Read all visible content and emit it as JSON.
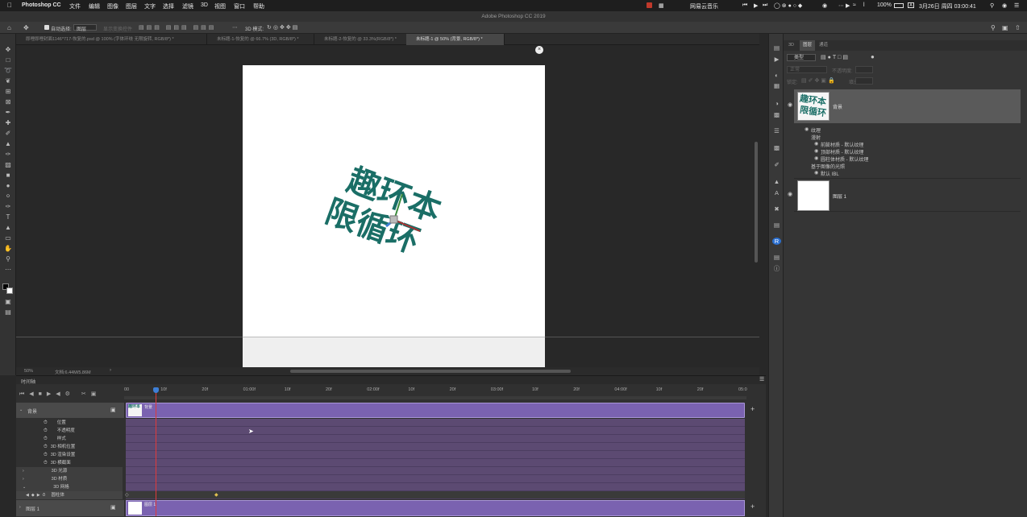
{
  "menubar": {
    "apple": "",
    "app_name": "Photoshop CC",
    "items": [
      "文件",
      "编辑",
      "图像",
      "图层",
      "文字",
      "选择",
      "滤镜",
      "3D",
      "视图",
      "窗口",
      "帮助"
    ],
    "netease": "网易云音乐",
    "battery": "100%",
    "datetime": "3月26日 周四 03:00:41"
  },
  "window_title": "Adobe Photoshop CC 2019",
  "options": {
    "auto_select": "自动选择:",
    "auto_select_target": "图层",
    "show_transform": "显示变换控件",
    "mode_3d": "3D 模式:"
  },
  "tabs": [
    "即哩即哩封面1146*717-恢复的.psd @ 100% (字体环绕 无限旋转, RGB/8*) *",
    "未标题-1-恢复的 @ 66.7% (3D, RGB/8*) *",
    "未标题-2-恢复的 @ 33.3%(RGB/8*) *",
    "未标题-1 @ 50% (背景, RGB/8*) *"
  ],
  "canvas_text": {
    "top_row": "趣环本",
    "bottom_row": "限循环"
  },
  "status": {
    "zoom": "50%",
    "doc": "文档:6.44M/5.86M"
  },
  "panel_tabs": [
    "3D",
    "图层",
    "通道"
  ],
  "layers_panel": {
    "filter_label": "类型",
    "blend_mode": "正常",
    "opacity_label": "不透明度:",
    "lock_label": "锁定:",
    "fill_label": "填充:",
    "layers": [
      {
        "name": "背景",
        "selected": true,
        "children": [
          {
            "name": "纹理",
            "indent": 0
          },
          {
            "name": "漫射",
            "indent": 1
          },
          {
            "name": "前膨材质 - 默认纹理",
            "indent": 2
          },
          {
            "name": "顶部材质 - 默认纹理",
            "indent": 2
          },
          {
            "name": "圆柱体材质 - 默认纹理",
            "indent": 2
          },
          {
            "name": "基于图像的光照",
            "indent": 1
          },
          {
            "name": "默认 IBL",
            "indent": 2
          }
        ]
      },
      {
        "name": "图层 1",
        "selected": false
      }
    ]
  },
  "timeline": {
    "panel_title": "时间轴",
    "ruler_labels": [
      "00",
      "10f",
      "20f",
      "01:00f",
      "10f",
      "20f",
      "02:00f",
      "10f",
      "20f",
      "03:00f",
      "10f",
      "20f",
      "04:00f",
      "10f",
      "20f",
      "05:0"
    ],
    "track1_name": "背景",
    "track1_clip": "背景",
    "properties": [
      "位置",
      "不透明度",
      "样式",
      "3D 相机位置",
      "3D 渲染设置",
      "3D 横截面"
    ],
    "groups": [
      "3D 光源",
      "3D 材质",
      "3D 网格"
    ],
    "sub_item": "圆柱体",
    "track2_name": "图层 1",
    "track2_clip": "图层 1",
    "playhead_fraction": 0.048
  },
  "colors": {
    "accent_purple": "#7a62b0",
    "text_teal": "#1a6e66",
    "playhead_red": "#e03a3a",
    "playhead_blue": "#3e7fd6"
  }
}
